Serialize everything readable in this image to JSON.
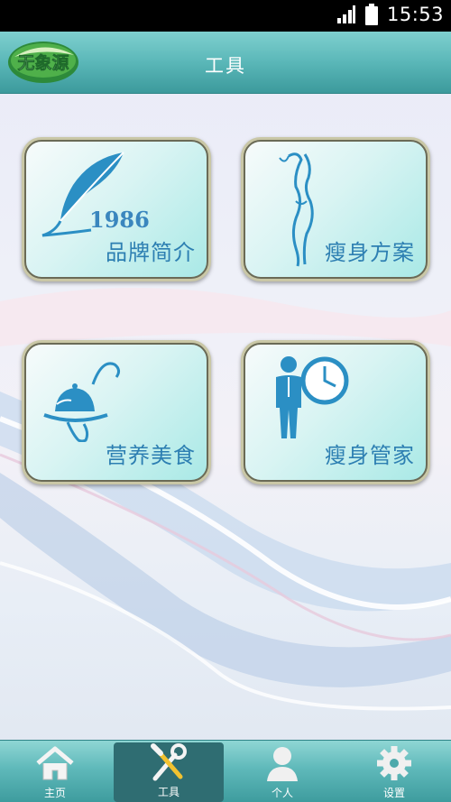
{
  "status_bar": {
    "time": "15:53"
  },
  "header": {
    "logo_text": "无象源",
    "title": "工具"
  },
  "tiles": [
    {
      "label": "品牌简介",
      "icon": "quill-icon",
      "icon_text": "1986"
    },
    {
      "label": "瘦身方案",
      "icon": "body-silhouette-icon"
    },
    {
      "label": "营养美食",
      "icon": "cloche-dish-icon"
    },
    {
      "label": "瘦身管家",
      "icon": "person-clock-icon"
    }
  ],
  "nav": {
    "items": [
      {
        "label": "主页",
        "icon": "home-icon"
      },
      {
        "label": "工具",
        "icon": "tools-icon",
        "active": true
      },
      {
        "label": "个人",
        "icon": "person-icon"
      },
      {
        "label": "设置",
        "icon": "gear-icon"
      }
    ]
  },
  "colors": {
    "accent": "#5ab7b8",
    "tile_text": "#2d7fb2",
    "icon_blue": "#2b8fc4"
  }
}
